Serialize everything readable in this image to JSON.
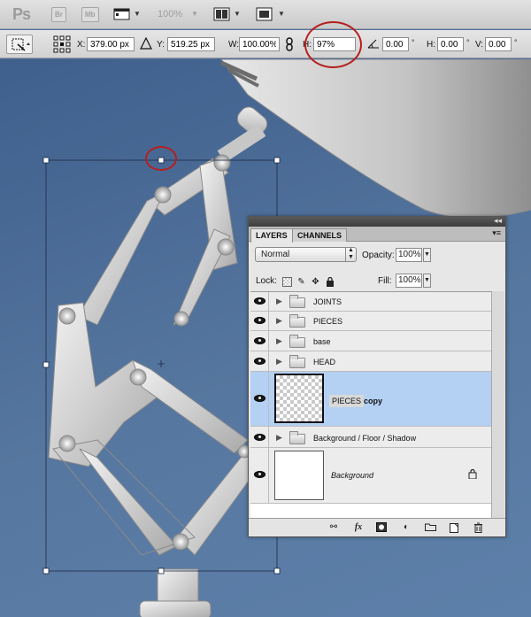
{
  "app": {
    "logo": "Ps",
    "bridge_button": "Br",
    "minibridge_button": "Mb",
    "zoom_level": "100%"
  },
  "options": {
    "x_label": "X:",
    "x_value": "379.00 px",
    "y_label": "Y:",
    "y_value": "519.25 px",
    "w_label": "W:",
    "w_value": "100.00%",
    "h_label": "H:",
    "h_value": "97%",
    "angle_value": "0.00",
    "angle_unit": "°",
    "hskew_label": "H:",
    "hskew_value": "0.00",
    "hskew_unit": "°",
    "vskew_label": "V:",
    "vskew_value": "0.00",
    "vskew_unit": "°"
  },
  "layers_panel": {
    "tabs": [
      "LAYERS",
      "CHANNELS"
    ],
    "active_tab": "LAYERS",
    "blend_mode": "Normal",
    "opacity_label": "Opacity:",
    "opacity_value": "100%",
    "lock_label": "Lock:",
    "fill_label": "Fill:",
    "fill_value": "100%",
    "layers": [
      {
        "name": "JOINTS",
        "type": "group",
        "visible": true
      },
      {
        "name": "PIECES",
        "type": "group",
        "visible": true
      },
      {
        "name": "base",
        "type": "group",
        "visible": true
      },
      {
        "name": "HEAD",
        "type": "group",
        "visible": true
      },
      {
        "name": "PIECES",
        "name_suffix": "copy",
        "type": "layer",
        "visible": true,
        "selected": true
      },
      {
        "name": "Background / Floor / Shadow",
        "type": "group",
        "visible": true
      },
      {
        "name": "Background",
        "type": "layer",
        "visible": true,
        "locked": true
      }
    ]
  },
  "colors": {
    "annotation": "#b51f1f",
    "selected_row": "#b4d0f3",
    "canvas_bg": "#4f6f9b"
  }
}
